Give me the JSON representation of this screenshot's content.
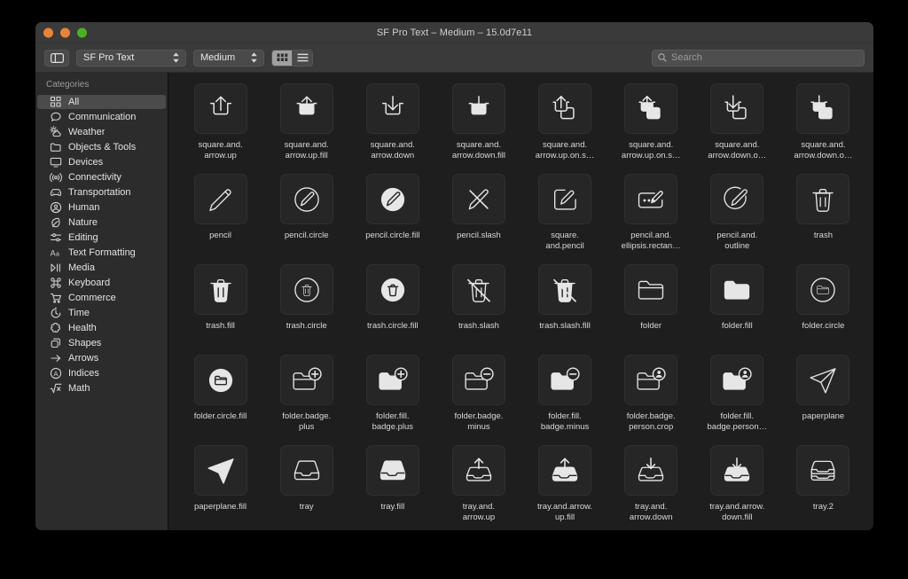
{
  "window": {
    "title": "SF Pro Text – Medium – 15.0d7e11",
    "traffic_lights": [
      {
        "name": "close",
        "color": "#e8833a"
      },
      {
        "name": "minimize",
        "color": "#e8833a"
      },
      {
        "name": "zoom",
        "color": "#4cb122"
      }
    ]
  },
  "toolbar": {
    "sidebar_toggle": "sidebar-toggle",
    "font_popup": {
      "value": "SF Pro Text"
    },
    "weight_popup": {
      "value": "Medium"
    },
    "view_modes": [
      {
        "name": "grid-view",
        "selected": true
      },
      {
        "name": "list-view",
        "selected": false
      }
    ],
    "search": {
      "placeholder": "Search",
      "value": ""
    }
  },
  "sidebar": {
    "header": "Categories",
    "items": [
      {
        "label": "All",
        "icon": "grid-icon",
        "selected": true
      },
      {
        "label": "Communication",
        "icon": "bubble-icon",
        "selected": false
      },
      {
        "label": "Weather",
        "icon": "cloud-sun-icon",
        "selected": false
      },
      {
        "label": "Objects & Tools",
        "icon": "folder-icon",
        "selected": false
      },
      {
        "label": "Devices",
        "icon": "display-icon",
        "selected": false
      },
      {
        "label": "Connectivity",
        "icon": "antenna-icon",
        "selected": false
      },
      {
        "label": "Transportation",
        "icon": "car-icon",
        "selected": false
      },
      {
        "label": "Human",
        "icon": "person-circle-icon",
        "selected": false
      },
      {
        "label": "Nature",
        "icon": "leaf-icon",
        "selected": false
      },
      {
        "label": "Editing",
        "icon": "sliders-icon",
        "selected": false
      },
      {
        "label": "Text Formatting",
        "icon": "textformat-icon",
        "selected": false
      },
      {
        "label": "Media",
        "icon": "play-pause-icon",
        "selected": false
      },
      {
        "label": "Keyboard",
        "icon": "command-icon",
        "selected": false
      },
      {
        "label": "Commerce",
        "icon": "cart-icon",
        "selected": false
      },
      {
        "label": "Time",
        "icon": "timer-icon",
        "selected": false
      },
      {
        "label": "Health",
        "icon": "cross-icon",
        "selected": false
      },
      {
        "label": "Shapes",
        "icon": "shapes-icon",
        "selected": false
      },
      {
        "label": "Arrows",
        "icon": "arrow-right-icon",
        "selected": false
      },
      {
        "label": "Indices",
        "icon": "a-circle-icon",
        "selected": false
      },
      {
        "label": "Math",
        "icon": "sqrt-icon",
        "selected": false
      }
    ]
  },
  "grid": {
    "symbols": [
      {
        "label": "square.and.\narrow.up",
        "glyph": "square-and-arrow-up"
      },
      {
        "label": "square.and.\narrow.up.fill",
        "glyph": "square-and-arrow-up-fill"
      },
      {
        "label": "square.and.\narrow.down",
        "glyph": "square-and-arrow-down"
      },
      {
        "label": "square.and.\narrow.down.fill",
        "glyph": "square-and-arrow-down-fill"
      },
      {
        "label": "square.and.\narrow.up.on.s…",
        "glyph": "square-and-arrow-up-on-square"
      },
      {
        "label": "square.and.\narrow.up.on.s…",
        "glyph": "square-and-arrow-up-on-square-fill"
      },
      {
        "label": "square.and.\narrow.down.o…",
        "glyph": "square-and-arrow-down-on-square"
      },
      {
        "label": "square.and.\narrow.down.o…",
        "glyph": "square-and-arrow-down-on-square-fill"
      },
      {
        "label": "pencil",
        "glyph": "pencil"
      },
      {
        "label": "pencil.circle",
        "glyph": "pencil-circle"
      },
      {
        "label": "pencil.circle.fill",
        "glyph": "pencil-circle-fill"
      },
      {
        "label": "pencil.slash",
        "glyph": "pencil-slash"
      },
      {
        "label": "square.\nand.pencil",
        "glyph": "square-and-pencil"
      },
      {
        "label": "pencil.and.\nellipsis.rectan…",
        "glyph": "pencil-and-ellipsis-rectangle"
      },
      {
        "label": "pencil.and.\noutline",
        "glyph": "pencil-and-outline"
      },
      {
        "label": "trash",
        "glyph": "trash"
      },
      {
        "label": "trash.fill",
        "glyph": "trash-fill"
      },
      {
        "label": "trash.circle",
        "glyph": "trash-circle"
      },
      {
        "label": "trash.circle.fill",
        "glyph": "trash-circle-fill"
      },
      {
        "label": "trash.slash",
        "glyph": "trash-slash"
      },
      {
        "label": "trash.slash.fill",
        "glyph": "trash-slash-fill"
      },
      {
        "label": "folder",
        "glyph": "folder"
      },
      {
        "label": "folder.fill",
        "glyph": "folder-fill"
      },
      {
        "label": "folder.circle",
        "glyph": "folder-circle"
      },
      {
        "label": "folder.circle.fill",
        "glyph": "folder-circle-fill"
      },
      {
        "label": "folder.badge.\nplus",
        "glyph": "folder-badge-plus"
      },
      {
        "label": "folder.fill.\nbadge.plus",
        "glyph": "folder-fill-badge-plus"
      },
      {
        "label": "folder.badge.\nminus",
        "glyph": "folder-badge-minus"
      },
      {
        "label": "folder.fill.\nbadge.minus",
        "glyph": "folder-fill-badge-minus"
      },
      {
        "label": "folder.badge.\nperson.crop",
        "glyph": "folder-badge-person-crop"
      },
      {
        "label": "folder.fill.\nbadge.person…",
        "glyph": "folder-fill-badge-person-crop"
      },
      {
        "label": "paperplane",
        "glyph": "paperplane"
      },
      {
        "label": "paperplane.fill",
        "glyph": "paperplane-fill"
      },
      {
        "label": "tray",
        "glyph": "tray"
      },
      {
        "label": "tray.fill",
        "glyph": "tray-fill"
      },
      {
        "label": "tray.and.\narrow.up",
        "glyph": "tray-and-arrow-up"
      },
      {
        "label": "tray.and.arrow.\nup.fill",
        "glyph": "tray-and-arrow-up-fill"
      },
      {
        "label": "tray.and.\narrow.down",
        "glyph": "tray-and-arrow-down"
      },
      {
        "label": "tray.and.arrow.\ndown.fill",
        "glyph": "tray-and-arrow-down-fill"
      },
      {
        "label": "tray.2",
        "glyph": "tray-2"
      }
    ]
  },
  "colors": {
    "window_bg": "#1e1e1e",
    "sidebar_bg": "#2c2c2c",
    "toolbar_bg": "#3a3a3a",
    "tile_bg": "#262626",
    "symbol": "#e6e6e6",
    "selection": "#4b4b4b"
  }
}
